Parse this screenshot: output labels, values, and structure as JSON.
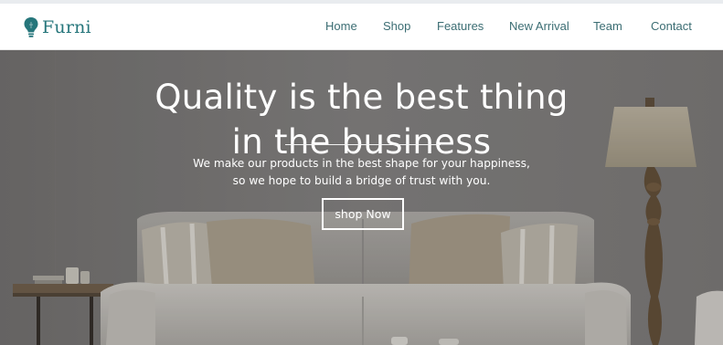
{
  "brand": {
    "name": "Furni",
    "icon": "lightbulb-icon",
    "color": "#26767b"
  },
  "nav": {
    "items": [
      {
        "label": "Home"
      },
      {
        "label": "Shop"
      },
      {
        "label": "Features"
      },
      {
        "label": "New Arrival"
      },
      {
        "label": "Team"
      },
      {
        "label": "Contact"
      }
    ],
    "color": "#3b6d73"
  },
  "hero": {
    "title_line1": "Quality is the best thing",
    "title_line2": "in the business",
    "subtitle_line1": "We make our products in the best shape for your happiness,",
    "subtitle_line2": "so we hope to build a bridge of trust with you.",
    "cta_label": "shop Now"
  }
}
